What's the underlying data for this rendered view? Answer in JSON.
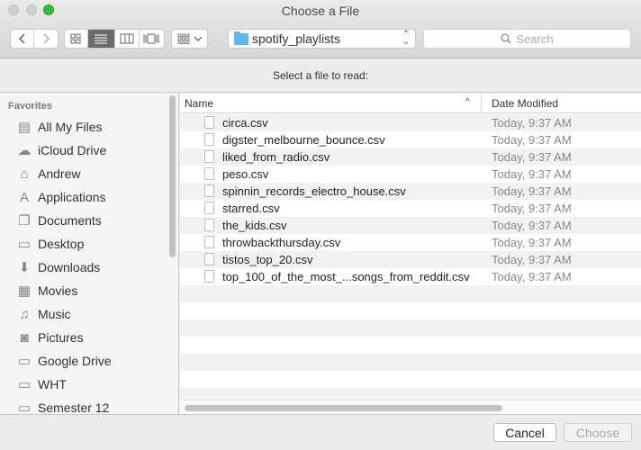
{
  "window": {
    "title": "Choose a File"
  },
  "toolbar": {
    "back_icon": "chevron-left-icon",
    "forward_icon": "chevron-right-icon",
    "view_modes": [
      {
        "name": "icon-view",
        "glyph": "⊞",
        "active": false
      },
      {
        "name": "list-view",
        "glyph": "☰",
        "active": true
      },
      {
        "name": "column-view",
        "glyph": "▥",
        "active": false
      },
      {
        "name": "coverflow-view",
        "glyph": "⫼",
        "active": false
      }
    ],
    "arrange_glyph": "▦",
    "arrange_chevron": "⌄",
    "location": "spotify_playlists",
    "search_placeholder": "Search"
  },
  "message": "Select a file to read:",
  "sidebar": {
    "section": "Favorites",
    "items": [
      {
        "label": "All My Files",
        "icon": "all-files-icon",
        "glyph": "▤"
      },
      {
        "label": "iCloud Drive",
        "icon": "cloud-icon",
        "glyph": "☁"
      },
      {
        "label": "Andrew",
        "icon": "home-icon",
        "glyph": "⌂"
      },
      {
        "label": "Applications",
        "icon": "applications-icon",
        "glyph": "A"
      },
      {
        "label": "Documents",
        "icon": "documents-icon",
        "glyph": "❐"
      },
      {
        "label": "Desktop",
        "icon": "desktop-icon",
        "glyph": "▭"
      },
      {
        "label": "Downloads",
        "icon": "downloads-icon",
        "glyph": "⬇"
      },
      {
        "label": "Movies",
        "icon": "movies-icon",
        "glyph": "▦"
      },
      {
        "label": "Music",
        "icon": "music-icon",
        "glyph": "♫"
      },
      {
        "label": "Pictures",
        "icon": "camera-icon",
        "glyph": "◙"
      },
      {
        "label": "Google Drive",
        "icon": "folder-icon",
        "glyph": "▭"
      },
      {
        "label": "WHT",
        "icon": "folder-icon",
        "glyph": "▭"
      },
      {
        "label": "Semester 12",
        "icon": "folder-icon",
        "glyph": "▭"
      }
    ]
  },
  "filelist": {
    "columns": {
      "name": "Name",
      "date": "Date Modified",
      "sort_glyph": "^"
    },
    "files": [
      {
        "name": "circa.csv",
        "date": "Today, 9:37 AM"
      },
      {
        "name": "digster_melbourne_bounce.csv",
        "date": "Today, 9:37 AM"
      },
      {
        "name": "liked_from_radio.csv",
        "date": "Today, 9:37 AM"
      },
      {
        "name": "peso.csv",
        "date": "Today, 9:37 AM"
      },
      {
        "name": "spinnin_records_electro_house.csv",
        "date": "Today, 9:37 AM"
      },
      {
        "name": "starred.csv",
        "date": "Today, 9:37 AM"
      },
      {
        "name": "the_kids.csv",
        "date": "Today, 9:37 AM"
      },
      {
        "name": "throwbackthursday.csv",
        "date": "Today, 9:37 AM"
      },
      {
        "name": "tistos_top_20.csv",
        "date": "Today, 9:37 AM"
      },
      {
        "name": "top_100_of_the_most_...songs_from_reddit.csv",
        "date": "Today, 9:37 AM"
      }
    ]
  },
  "buttons": {
    "cancel": "Cancel",
    "choose": "Choose"
  }
}
